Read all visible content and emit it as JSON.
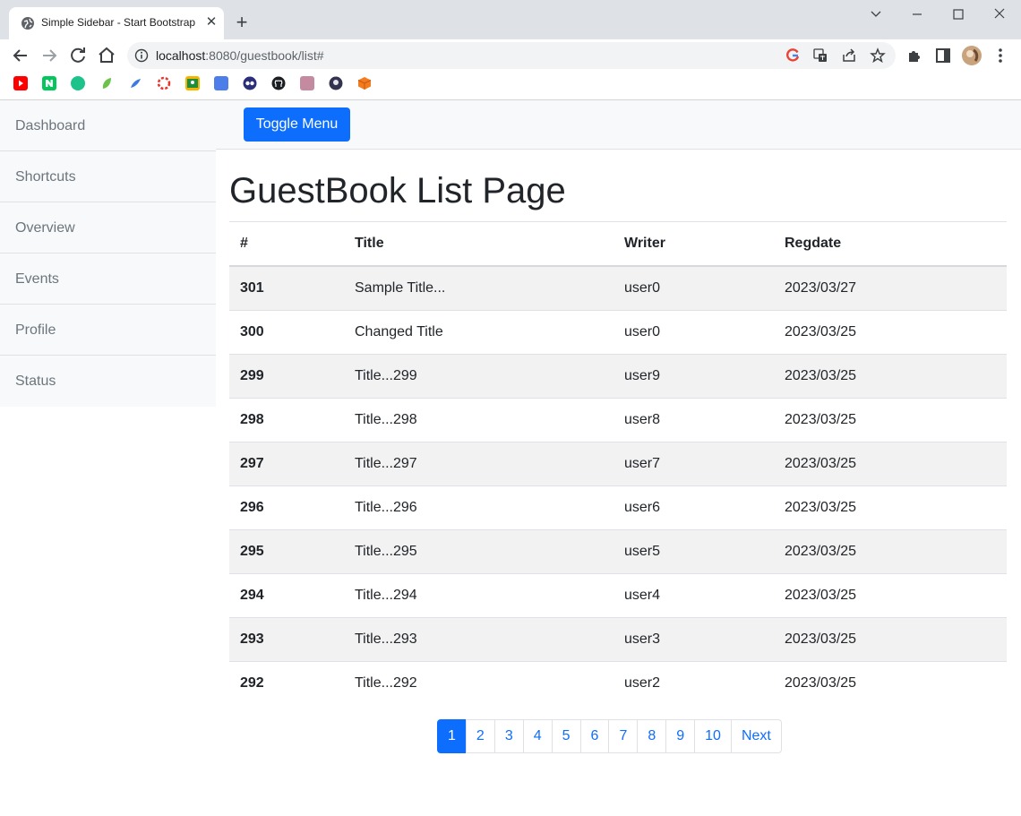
{
  "browser": {
    "tab_title": "Simple Sidebar - Start Bootstrap",
    "url_host": "localhost",
    "url_rest": ":8080/guestbook/list#",
    "bookmark_icons": [
      "youtube-icon",
      "naver-icon",
      "green-app-icon",
      "leaf-icon",
      "blue-feather-icon",
      "red-circle-icon",
      "google-classroom-icon",
      "blue-grid-icon",
      "dark-owl-icon",
      "github-icon",
      "pixel-avatar-icon",
      "dark-character-icon",
      "orange-cube-icon"
    ]
  },
  "sidebar": {
    "items": [
      {
        "label": "Dashboard"
      },
      {
        "label": "Shortcuts"
      },
      {
        "label": "Overview"
      },
      {
        "label": "Events"
      },
      {
        "label": "Profile"
      },
      {
        "label": "Status"
      }
    ]
  },
  "topnav": {
    "toggle_label": "Toggle Menu"
  },
  "page": {
    "title": "GuestBook List Page"
  },
  "table": {
    "headers": [
      "#",
      "Title",
      "Writer",
      "Regdate"
    ],
    "rows": [
      {
        "num": "301",
        "title": "Sample Title...",
        "writer": "user0",
        "regdate": "2023/03/27"
      },
      {
        "num": "300",
        "title": "Changed Title",
        "writer": "user0",
        "regdate": "2023/03/25"
      },
      {
        "num": "299",
        "title": "Title...299",
        "writer": "user9",
        "regdate": "2023/03/25"
      },
      {
        "num": "298",
        "title": "Title...298",
        "writer": "user8",
        "regdate": "2023/03/25"
      },
      {
        "num": "297",
        "title": "Title...297",
        "writer": "user7",
        "regdate": "2023/03/25"
      },
      {
        "num": "296",
        "title": "Title...296",
        "writer": "user6",
        "regdate": "2023/03/25"
      },
      {
        "num": "295",
        "title": "Title...295",
        "writer": "user5",
        "regdate": "2023/03/25"
      },
      {
        "num": "294",
        "title": "Title...294",
        "writer": "user4",
        "regdate": "2023/03/25"
      },
      {
        "num": "293",
        "title": "Title...293",
        "writer": "user3",
        "regdate": "2023/03/25"
      },
      {
        "num": "292",
        "title": "Title...292",
        "writer": "user2",
        "regdate": "2023/03/25"
      }
    ]
  },
  "pagination": {
    "pages": [
      "1",
      "2",
      "3",
      "4",
      "5",
      "6",
      "7",
      "8",
      "9",
      "10"
    ],
    "active_page": "1",
    "next_label": "Next"
  },
  "colors": {
    "primary": "#0d6efd",
    "sidebar_bg": "#f8f9fa",
    "striped_row": "#f2f2f2",
    "muted_text": "#6c757d"
  }
}
